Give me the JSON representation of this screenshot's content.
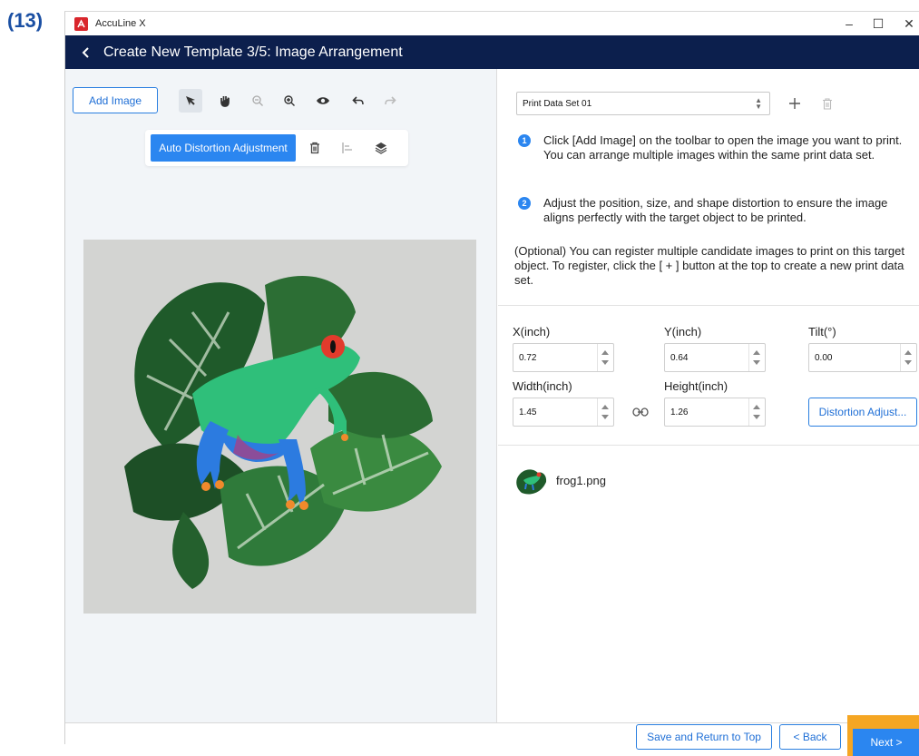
{
  "step_label": "(13)",
  "app": {
    "title": "AccuLine X",
    "logo_icon": "acculine-logo-icon",
    "brand_color": "#d9262c"
  },
  "window_controls": {
    "minimize": "–",
    "maximize": "☐",
    "close": "✕"
  },
  "header": {
    "title": "Create New Template 3/5: Image Arrangement",
    "bg_color": "#0c1f4d"
  },
  "toolbar": {
    "add_image_label": "Add Image",
    "icons": [
      "select-arrow-icon",
      "hand-pan-icon",
      "zoom-out-icon",
      "zoom-in-icon",
      "eye-preview-icon",
      "undo-icon",
      "redo-icon"
    ]
  },
  "floating_toolbar": {
    "auto_distortion_label": "Auto Distortion Adjustment",
    "icons": [
      "trash-icon",
      "align-left-icon",
      "layers-icon"
    ]
  },
  "canvas": {
    "image_alt": "frog on monstera leaves"
  },
  "right": {
    "print_data_set": {
      "selected": "Print Data Set 01"
    },
    "instructions": [
      {
        "num": "1",
        "text": "Click [Add Image] on the toolbar to open the image you want to print. You can arrange multiple images within the same print data set."
      },
      {
        "num": "2",
        "text": "Adjust the position, size, and shape distortion to ensure the image aligns perfectly with the target object to be printed."
      }
    ],
    "optional_note": "(Optional) You can register multiple candidate images to print on this target object. To register, click the [ + ] button at the top to create a new print data set.",
    "fields": {
      "x_label": "X(inch)",
      "x_value": "0.72",
      "y_label": "Y(inch)",
      "y_value": "0.64",
      "tilt_label": "Tilt(°)",
      "tilt_value": "0.00",
      "width_label": "Width(inch)",
      "width_value": "1.45",
      "height_label": "Height(inch)",
      "height_value": "1.26",
      "distortion_label": "Distortion Adjust..."
    },
    "file": {
      "name": "frog1.png"
    }
  },
  "footer": {
    "save_label": "Save and Return to Top",
    "back_label": "< Back",
    "next_label": "Next >"
  },
  "colors": {
    "accent": "#2b86f0",
    "highlight": "#f5a623"
  }
}
